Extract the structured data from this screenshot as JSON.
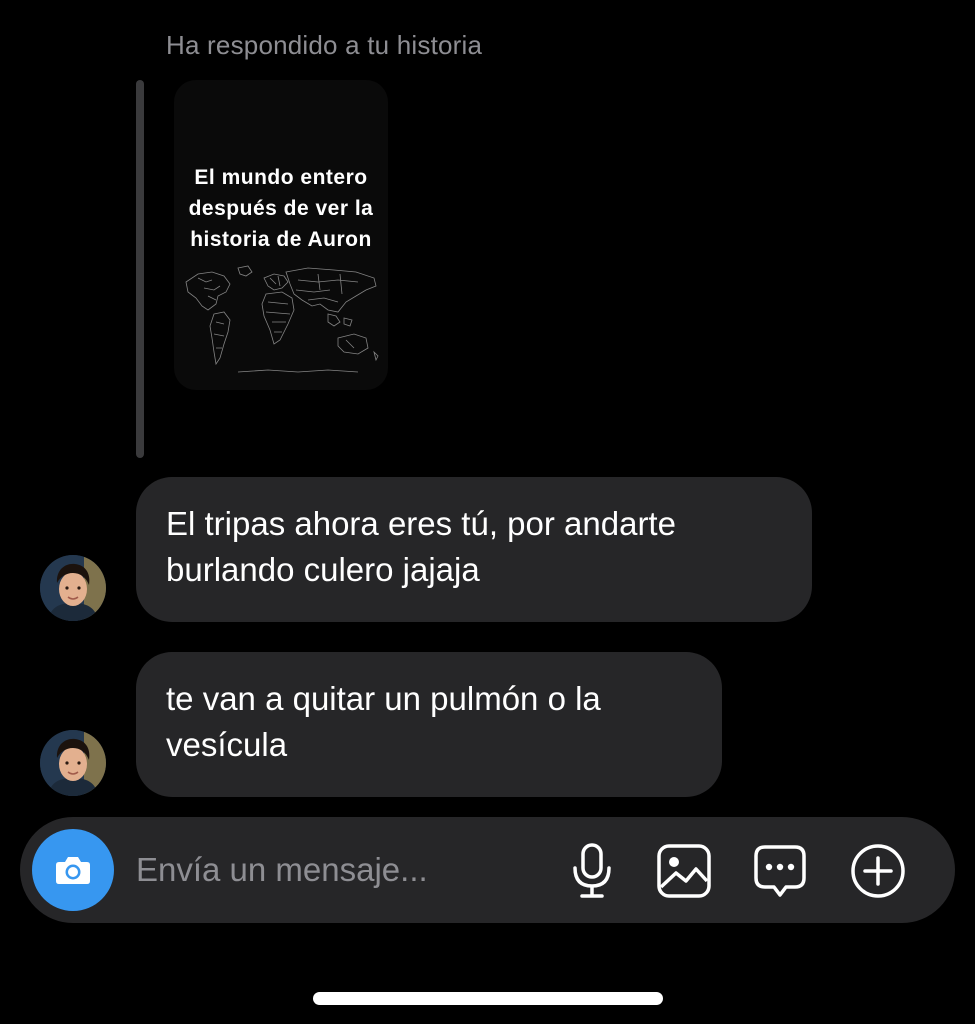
{
  "reply": {
    "caption": "Ha respondido a tu historia",
    "story_text_lines": [
      "El mundo entero",
      "después de ver la",
      "historia de Auron"
    ]
  },
  "messages": [
    {
      "lines": [
        "El tripas ahora eres tú, por andarte",
        "burlando culero jajaja"
      ]
    },
    {
      "lines": [
        "te van a quitar un pulmón o la",
        "vesícula"
      ]
    }
  ],
  "composer": {
    "placeholder": "Envía un mensaje...",
    "icons": [
      "camera-icon",
      "microphone-icon",
      "gallery-icon",
      "sticker-icon",
      "plus-circle-icon"
    ]
  },
  "colors": {
    "background": "#000000",
    "bubble": "#262628",
    "camera_button": "#3797f0",
    "caption_text": "#8e8e93"
  }
}
